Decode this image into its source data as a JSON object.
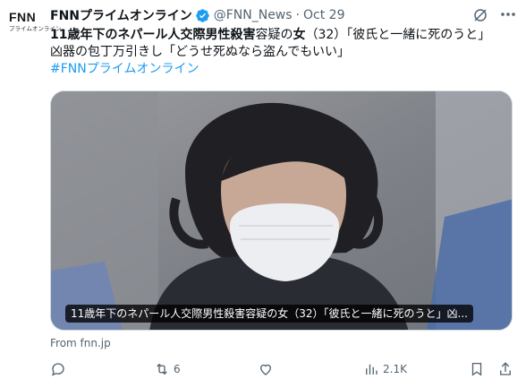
{
  "account": {
    "display_name": "FNNプライムオンライン",
    "handle": "@FNN_News",
    "separator": "·",
    "date": "Oct 29",
    "avatar_text": "FNN",
    "avatar_subtext": "プライムオンライン"
  },
  "post": {
    "line1_bold": "11歳年下のネパール人交際男性殺害",
    "line1_mid": "容疑の",
    "line1_bold2": "女",
    "line1_rest": "（32）「彼氏と一緒に死のうと」",
    "line2": "凶器の包丁万引きし「どうせ死ぬなら盗んでもいい」",
    "hashtag": "#FNNプライムオンライン"
  },
  "media": {
    "caption": "11歳年下のネパール人交際男性殺害容疑の女（32）「彼氏と一緒に死のうと」凶..."
  },
  "link_source": "From fnn.jp",
  "actions": {
    "reply_count": "",
    "repost_count": "6",
    "like_count": "",
    "views_count": "2.1K"
  },
  "colors": {
    "accent": "#1d9bf0",
    "secondary_text": "#536471",
    "verified": "#1d9bf0"
  },
  "icons": [
    "grok-icon",
    "more-icon",
    "verified-badge-icon",
    "reply-icon",
    "repost-icon",
    "like-icon",
    "views-icon",
    "bookmark-icon"
  ]
}
